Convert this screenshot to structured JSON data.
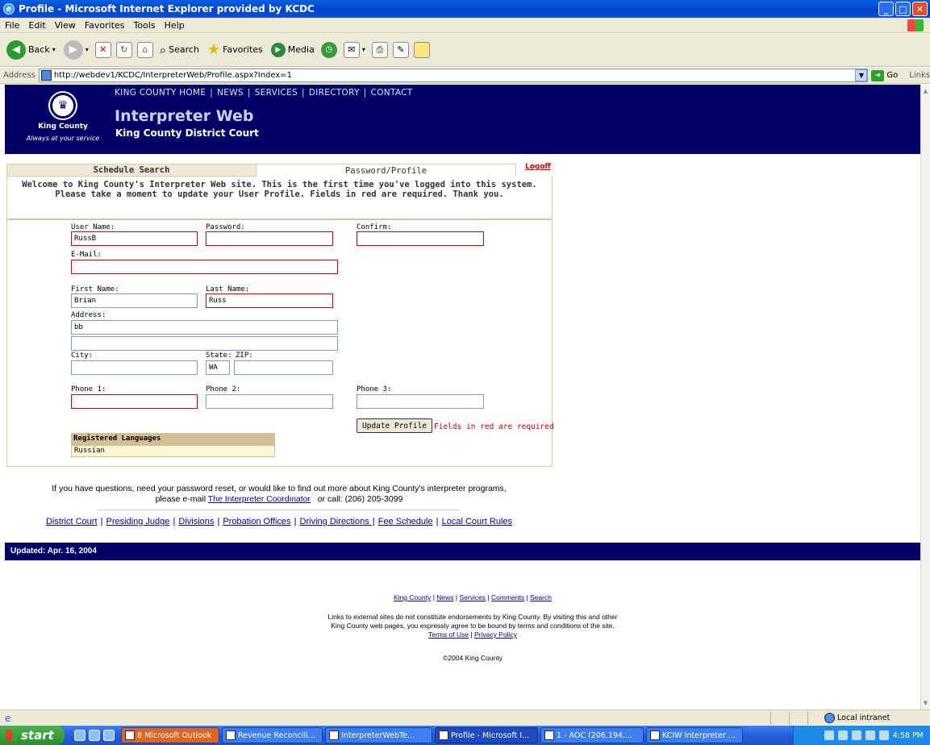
{
  "window": {
    "title": "Profile - Microsoft Internet Explorer provided by KCDC"
  },
  "menu": [
    "File",
    "Edit",
    "View",
    "Favorites",
    "Tools",
    "Help"
  ],
  "toolbar": {
    "back": "Back",
    "search": "Search",
    "favorites": "Favorites",
    "media": "Media"
  },
  "address": {
    "label": "Address",
    "url": "http://webdev1/KCDC/InterpreterWeb/Profile.aspx?Index=1",
    "go": "Go",
    "links": "Links"
  },
  "banner": {
    "logo_name": "King County",
    "logo_tagline": "Always at your service",
    "nav": [
      "KING COUNTY HOME",
      "NEWS",
      "SERVICES",
      "DIRECTORY",
      "CONTACT"
    ],
    "title": "Interpreter Web",
    "subtitle": "King County District Court"
  },
  "tabs": [
    {
      "label": "Schedule Search"
    },
    {
      "label": "Password/Profile"
    }
  ],
  "logoff": "Logoff",
  "welcome": {
    "line1": "Welcome to King County's Interpreter Web site. This is the first time you've logged into this system.",
    "line2": "Please take a moment to update your User Profile. Fields in red are required. Thank you."
  },
  "form": {
    "username": {
      "label": "User Name:",
      "value": "RussB"
    },
    "password": {
      "label": "Password:",
      "value": ""
    },
    "confirm": {
      "label": "Confirm:",
      "value": ""
    },
    "email": {
      "label": "E-Mail:",
      "value": ""
    },
    "firstname": {
      "label": "First Name:",
      "value": "Brian"
    },
    "lastname": {
      "label": "Last Name:",
      "value": "Russ"
    },
    "address": {
      "label": "Address:",
      "line1": "bb",
      "line2": ""
    },
    "city": {
      "label": "City:",
      "value": ""
    },
    "state": {
      "label": "State:",
      "value": "WA"
    },
    "zip": {
      "label": "ZIP:",
      "value": ""
    },
    "phone1": {
      "label": "Phone 1:",
      "value": ""
    },
    "phone2": {
      "label": "Phone 2:",
      "value": ""
    },
    "phone3": {
      "label": "Phone 3:",
      "value": ""
    },
    "update_button": "Update Profile",
    "required_note": "Fields in red are required"
  },
  "languages": {
    "header": "Registered Languages",
    "items": [
      "Russian"
    ]
  },
  "questions": {
    "line1": "If you have questions, need your password reset, or would like to find out more about King County's interpreter programs,",
    "prefix": "please e-mail",
    "link": "The Interpreter Coordinator",
    "suffix": "or call: (206) 205-3099"
  },
  "footer_links": [
    "District Court",
    "Presiding Judge",
    "Divisions",
    "Probation Offices",
    "Driving Directions ",
    "Fee Schedule",
    "Local Court Rules"
  ],
  "updated": "Updated: Apr. 16, 2004",
  "bottom_links": [
    "King County",
    "News",
    "Services",
    "Comments",
    "Search"
  ],
  "disclaimer": {
    "line1": "Links to external sites do not constitute endorsements by King County. By visiting this and other",
    "line2": "King County web pages, you expressly agree to be bound by terms and conditions of the site.",
    "terms": "Terms of Use",
    "privacy": "Privacy Policy"
  },
  "copyright": "©2004 King County",
  "statusbar": {
    "zone": "Local intranet"
  },
  "taskbar": {
    "start": "start",
    "tasks": [
      "8 Microsoft Outlook",
      "Revenue Reconcili...",
      "InterpreterWebTe...",
      "Profile - Microsoft I...",
      "1 - AOC (206.194....",
      "KCIW Interpreter ..."
    ],
    "clock": "4:58 PM"
  }
}
